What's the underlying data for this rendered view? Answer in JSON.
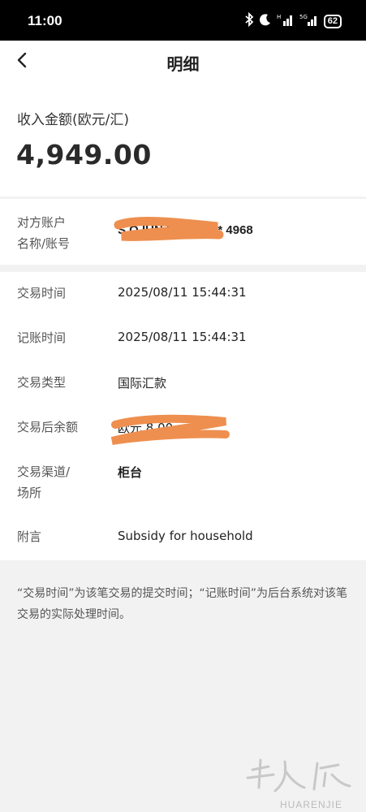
{
  "status_bar": {
    "time": "11:00",
    "battery": "62"
  },
  "header": {
    "title": "明细"
  },
  "amount": {
    "label": "收入金额(欧元/汇)",
    "value": "4,949.00"
  },
  "counterparty": {
    "label_line1": "对方账户",
    "label_line2": "名称/账号",
    "value": "S          O IUN IT81 ****** 4968"
  },
  "details": [
    {
      "label": "交易时间",
      "value": "2025/08/11 15:44:31"
    },
    {
      "label": "记账时间",
      "value": "2025/08/11 15:44:31"
    },
    {
      "label": "交易类型",
      "value": "国际汇款"
    },
    {
      "label": "交易后余额",
      "value": "欧元       8.00"
    },
    {
      "label_line1": "交易渠道/",
      "label_line2": "场所",
      "value": "柜台"
    },
    {
      "label": "附言",
      "value": "Subsidy for household"
    }
  ],
  "note": "“交易时间”为该笔交易的提交时间；“记账时间”为后台系统对该笔交易的实际处理时间。",
  "watermark": {
    "text": "HUARENJIE"
  },
  "colors": {
    "redaction": "#ee8f4f",
    "background": "#f2f2f2",
    "card": "#ffffff"
  }
}
